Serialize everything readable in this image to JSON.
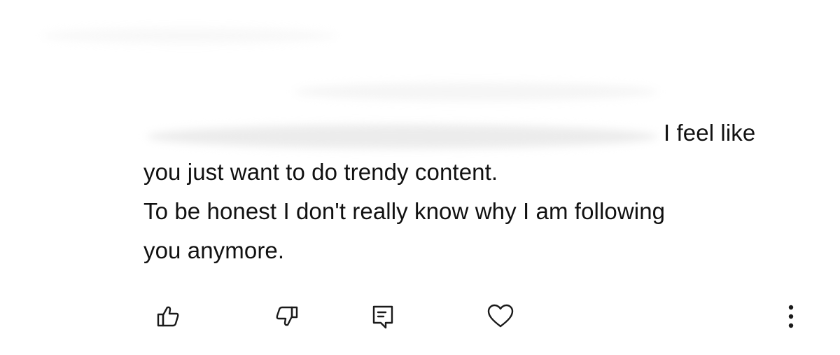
{
  "comment": {
    "lines": [
      "I feel like",
      "you just want to do trendy content.",
      "To be honest I don't really know why I am following",
      "you anymore."
    ]
  },
  "actions": {
    "like_icon": "thumbs-up-outline",
    "dislike_icon": "thumbs-down-outline",
    "reply_icon": "comment-outline",
    "heart_icon": "heart-outline",
    "more_icon": "vertical-ellipsis"
  },
  "colors": {
    "text": "#111111",
    "icon": "#1a1a1a",
    "background": "#ffffff"
  }
}
